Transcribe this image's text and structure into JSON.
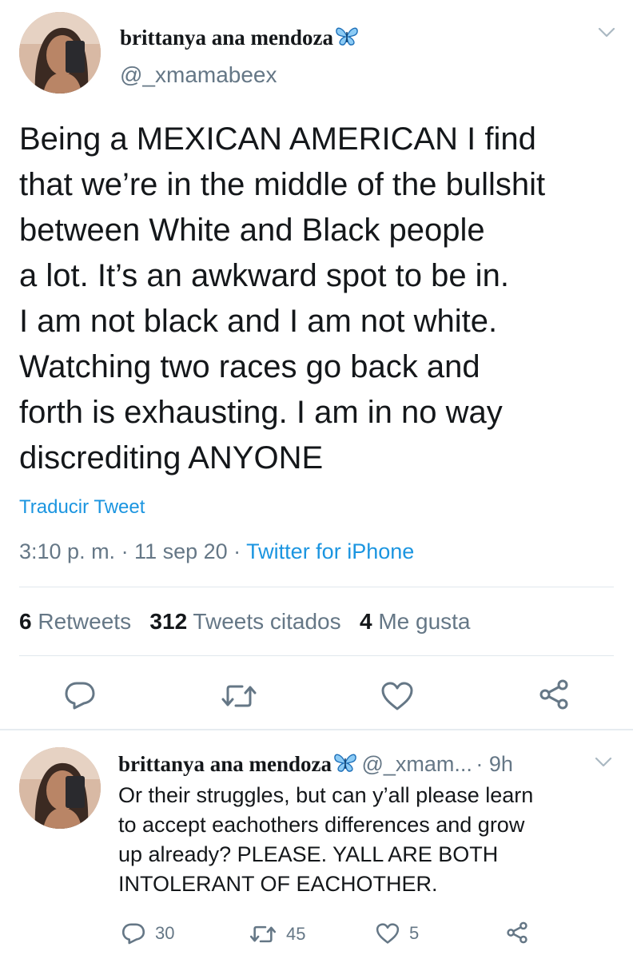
{
  "main_tweet": {
    "author_name": "brittanya ana mendoza",
    "author_handle": "@_xmamabeex",
    "text_lines": [
      "Being a MEXICAN AMERICAN I find",
      "that we’re in the middle of the bullshit",
      "between White and Black people",
      "a lot. It’s an awkward spot to be in.",
      "I am not black and I am not white.",
      "Watching two races go back and",
      "forth is exhausting. I am in no way",
      "discrediting ANYONE"
    ],
    "translate_label": "Traducir Tweet",
    "timestamp": "3:10 p. m. · 11 sep 20 · ",
    "source": "Twitter for iPhone",
    "stats": {
      "retweets_count": "6",
      "retweets_label": "Retweets",
      "quotes_count": "312",
      "quotes_label": "Tweets citados",
      "likes_count": "4",
      "likes_label": "Me gusta"
    }
  },
  "reply_tweet": {
    "author_name": "brittanya ana mendoza",
    "author_handle": "@_xmam...",
    "time": "· 9h",
    "text_lines": [
      "Or their struggles, but can y’all please learn",
      "to accept eachothers differences and grow",
      "up already? PLEASE. YALL ARE BOTH",
      "INTOLERANT OF EACHOTHER."
    ],
    "reply_count": "30",
    "retweet_count": "45",
    "like_count": "5"
  },
  "colors": {
    "text": "#14171a",
    "secondary": "#657786",
    "link": "#1b95e0",
    "divider": "#e1e8ed",
    "butterfly": "#1da1f2"
  },
  "icons": [
    "chevron-down-icon",
    "butterfly-emoji-icon",
    "reply-icon",
    "retweet-icon",
    "like-icon",
    "share-icon"
  ]
}
